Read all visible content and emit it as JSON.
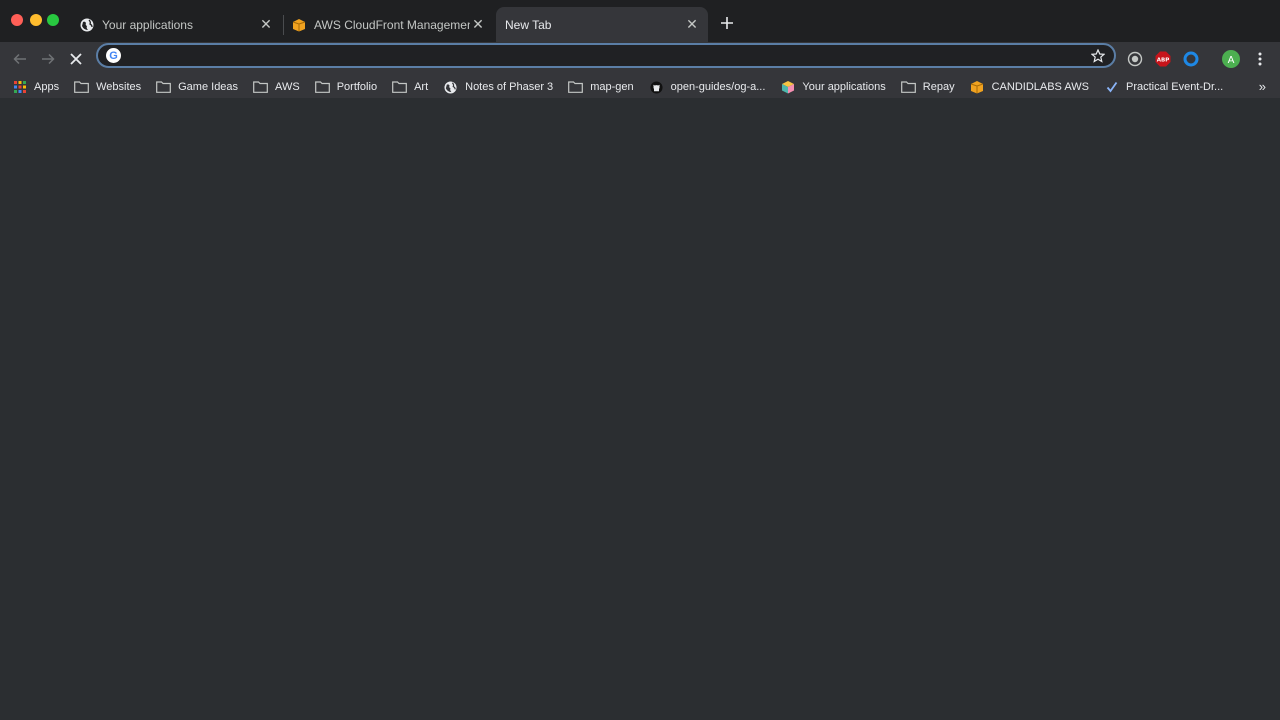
{
  "window": {
    "controls": [
      "close",
      "minimize",
      "maximize"
    ]
  },
  "tabs": [
    {
      "title": "Your applications",
      "icon": "globe-icon"
    },
    {
      "title": "AWS CloudFront Management",
      "icon": "aws-box-icon"
    },
    {
      "title": "New Tab",
      "icon": "",
      "active": true
    }
  ],
  "toolbar": {
    "address_value": "",
    "address_placeholder": "",
    "reload_state": "stop-loading"
  },
  "extensions": [
    "target-icon",
    "adblock-plus-icon",
    "blue-ring-icon",
    "profile-avatar",
    "menu-icon"
  ],
  "profile": {
    "initial": "A",
    "color": "#4caf50"
  },
  "bookmarks": [
    {
      "label": "Apps",
      "icon": "apps-grid-icon"
    },
    {
      "label": "Websites",
      "icon": "folder-icon"
    },
    {
      "label": "Game Ideas",
      "icon": "folder-icon"
    },
    {
      "label": "AWS",
      "icon": "folder-icon"
    },
    {
      "label": "Portfolio",
      "icon": "folder-icon"
    },
    {
      "label": "Art",
      "icon": "folder-icon"
    },
    {
      "label": "Notes of Phaser 3",
      "icon": "globe-icon"
    },
    {
      "label": "map-gen",
      "icon": "folder-icon"
    },
    {
      "label": "open-guides/og-a...",
      "icon": "github-icon"
    },
    {
      "label": "Your applications",
      "icon": "cube-icon"
    },
    {
      "label": "Repay",
      "icon": "folder-icon"
    },
    {
      "label": "CANDIDLABS AWS",
      "icon": "aws-box-icon"
    },
    {
      "label": "Practical Event-Dr...",
      "icon": "check-icon"
    }
  ],
  "bookmarks_overflow": "»",
  "colors": {
    "background": "#2b2e31",
    "tabstrip": "#1f2022",
    "toolbar": "#35363a",
    "omnibox_focus": "#5b7ea6"
  }
}
